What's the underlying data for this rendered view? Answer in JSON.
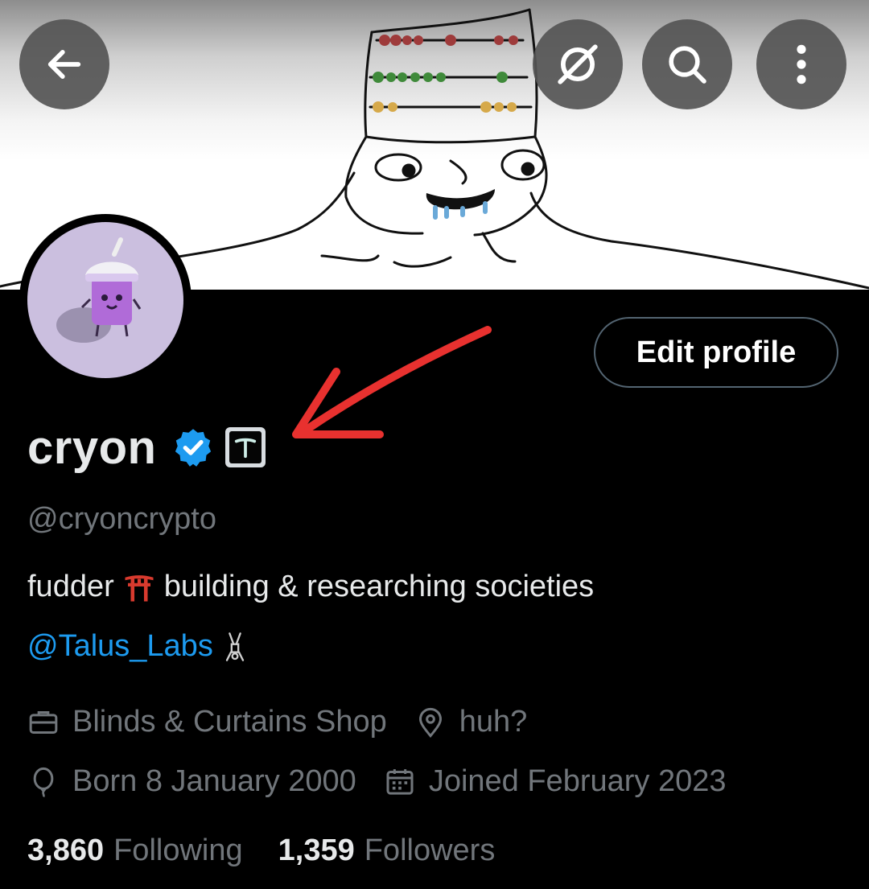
{
  "profile": {
    "display_name": "cryon",
    "handle": "@cryoncrypto",
    "bio_line1_a": "fudder",
    "bio_line1_b": "building & researching societies",
    "bio_mention": "@Talus_Labs",
    "work": "Blinds & Curtains Shop",
    "location": "huh?",
    "born": "Born 8 January 2000",
    "joined": "Joined February 2023"
  },
  "stats": {
    "following_count": "3,860",
    "following_label": "Following",
    "followers_count": "1,359",
    "followers_label": "Followers"
  },
  "actions": {
    "edit_profile": "Edit profile"
  },
  "icons": {
    "back": "arrow-left-icon",
    "no_grok": "slashed-circle-icon",
    "search": "search-icon",
    "more": "more-vertical-icon",
    "verified": "verified-badge-icon",
    "affiliate": "affiliate-logo-icon",
    "torii": "torii-gate-emoji",
    "acrobat": "person-cartwheel-emoji",
    "work": "briefcase-icon",
    "location": "location-pin-icon",
    "birthday": "balloon-icon",
    "calendar": "calendar-icon"
  },
  "colors": {
    "accent": "#1d9bf0",
    "muted_text": "#71767b",
    "annotation_arrow": "#e8312f"
  }
}
